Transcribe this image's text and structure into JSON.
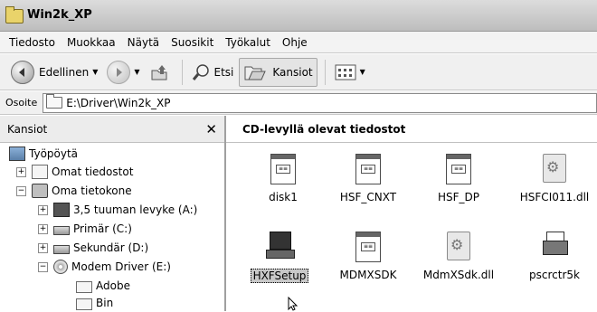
{
  "window": {
    "title": "Win2k_XP"
  },
  "menu": [
    "Tiedosto",
    "Muokkaa",
    "Näytä",
    "Suosikit",
    "Työkalut",
    "Ohje"
  ],
  "toolbar": {
    "back_label": "Edellinen",
    "search_label": "Etsi",
    "folders_label": "Kansiot"
  },
  "address": {
    "label": "Osoite",
    "value": "E:\\Driver\\Win2k_XP"
  },
  "tree": {
    "header": "Kansiot",
    "close": "✕",
    "nodes": [
      {
        "label": "Työpöytä",
        "icon": "desktop-icon",
        "expander": ""
      },
      {
        "label": "Omat tiedostot",
        "icon": "my-documents-icon",
        "expander": "+"
      },
      {
        "label": "Oma tietokone",
        "icon": "my-computer-icon",
        "expander": "−"
      },
      {
        "label": "3,5 tuuman levyke (A:)",
        "icon": "floppy-drive-icon",
        "expander": "+"
      },
      {
        "label": "Primär (C:)",
        "icon": "hard-drive-icon",
        "expander": "+"
      },
      {
        "label": "Sekundär (D:)",
        "icon": "hard-drive-icon",
        "expander": "+"
      },
      {
        "label": "Modem Driver (E:)",
        "icon": "cd-drive-icon",
        "expander": "−"
      },
      {
        "label": "Adobe",
        "icon": "folder-icon",
        "expander": ""
      },
      {
        "label": "Bin",
        "icon": "folder-icon",
        "expander": ""
      }
    ]
  },
  "files_header": "CD-levyllä olevat tiedostot",
  "files": [
    {
      "name": "disk1",
      "icon": "document-icon"
    },
    {
      "name": "HSF_CNXT",
      "icon": "document-icon"
    },
    {
      "name": "HSF_DP",
      "icon": "document-icon"
    },
    {
      "name": "HSFCI011.dll",
      "icon": "dll-icon"
    },
    {
      "name": "HXFSetup",
      "icon": "setup-app-icon",
      "selected": true
    },
    {
      "name": "MDMXSDK",
      "icon": "document-icon"
    },
    {
      "name": "MdmXSdk.dll",
      "icon": "dll-icon"
    },
    {
      "name": "pscrctr5k",
      "icon": "printer-icon"
    }
  ]
}
